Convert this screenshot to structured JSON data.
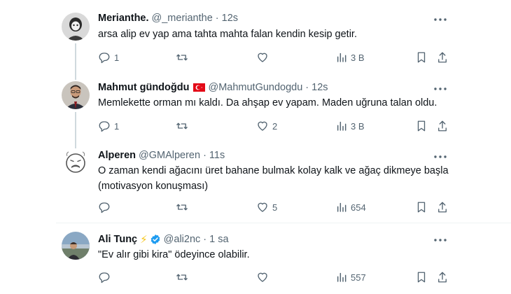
{
  "tweets": [
    {
      "name": "Merianthe.",
      "handle": "@_merianthe",
      "dot": "·",
      "time": "12s",
      "text": "arsa alip ev yap ama tahta mahta falan kendin kesip getir.",
      "replies": "1",
      "retweets": "",
      "likes": "",
      "views": "3 B"
    },
    {
      "name": "Mahmut gündoğdu",
      "handle": "@MahmutGundogdu",
      "dot": "·",
      "time": "12s",
      "text": "Memlekette orman mı kaldı. Da ahşap ev yapam. Maden uğruna talan oldu.",
      "replies": "1",
      "retweets": "",
      "likes": "2",
      "views": "3 B"
    },
    {
      "name": "Alperen",
      "handle": "@GMAlperen",
      "dot": "·",
      "time": "11s",
      "text": "O zaman kendi ağacını üret bahane bulmak kolay kalk ve ağaç dikmeye başla (motivasyon konuşması)",
      "replies": "",
      "retweets": "",
      "likes": "5",
      "views": "654"
    },
    {
      "name": "Ali Tunç",
      "handle": "@ali2nc",
      "dot": "·",
      "time": "1 sa",
      "text": "\"Ev alır gibi kira\" ödeyince olabilir.",
      "replies": "",
      "retweets": "",
      "likes": "",
      "views": "557",
      "bolt": "⚡"
    }
  ],
  "colors": {
    "text": "#0f1419",
    "muted": "#536471",
    "thread_line": "#cfd9de",
    "verified": "#1d9bf0",
    "flag": "#e30a17"
  },
  "icons": [
    "more-icon",
    "reply-icon",
    "retweet-icon",
    "like-icon",
    "views-icon",
    "bookmark-icon",
    "share-icon",
    "verified-icon",
    "turkey-flag-icon"
  ]
}
